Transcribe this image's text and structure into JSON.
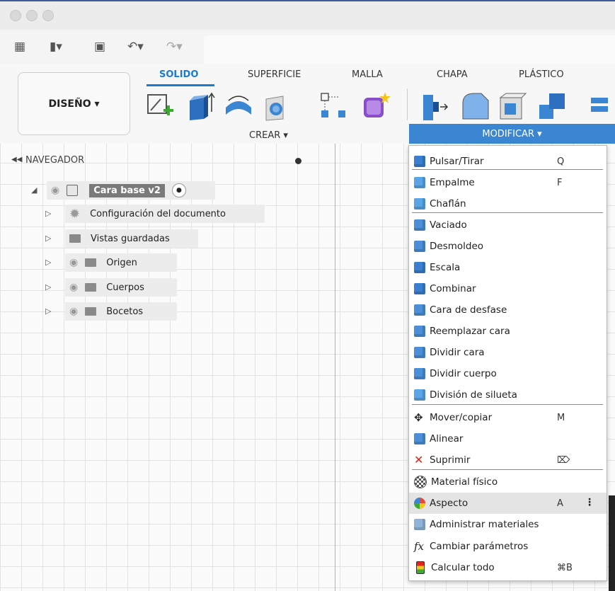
{
  "window": {
    "controls": [
      "close",
      "minimize",
      "zoom"
    ]
  },
  "quick_toolbar": {
    "icons": [
      "grid-icon",
      "file-icon",
      "save-icon",
      "undo-icon",
      "redo-icon"
    ]
  },
  "ribbon": {
    "workspace_button": "DISEÑO ▾",
    "tabs": [
      {
        "label": "SOLIDO",
        "active": true
      },
      {
        "label": "SUPERFICIE",
        "active": false
      },
      {
        "label": "MALLA",
        "active": false
      },
      {
        "label": "CHAPA",
        "active": false
      },
      {
        "label": "PLÁSTICO",
        "active": false
      }
    ],
    "groups": {
      "crear": "CREAR ▾",
      "modificar": "MODIFICAR ▾"
    },
    "accent": "#1a7bd0"
  },
  "navigator": {
    "title": "NAVEGADOR",
    "root": "Cara base v2",
    "items": [
      {
        "label": "Configuración del documento",
        "icon": "gear-icon"
      },
      {
        "label": "Vistas guardadas",
        "icon": "folder-icon"
      },
      {
        "label": "Origen",
        "icon": "folder-icon"
      },
      {
        "label": "Cuerpos",
        "icon": "folder-icon"
      },
      {
        "label": "Bocetos",
        "icon": "folder-icon"
      }
    ]
  },
  "menu": {
    "items": [
      {
        "label": "Pulsar/Tirar",
        "shortcut": "Q",
        "icon": "press-pull-icon",
        "color": "#3a7fd0"
      },
      {
        "label": "Empalme",
        "shortcut": "F",
        "icon": "fillet-icon",
        "color": "#5aa5e8"
      },
      {
        "label": "Chaflán",
        "shortcut": "",
        "icon": "chamfer-icon",
        "color": "#5aa5e8"
      },
      {
        "label": "Vaciado",
        "shortcut": "",
        "icon": "shell-icon",
        "color": "#4a8fd8"
      },
      {
        "label": "Desmoldeo",
        "shortcut": "",
        "icon": "draft-icon",
        "color": "#4a8fd8"
      },
      {
        "label": "Escala",
        "shortcut": "",
        "icon": "scale-icon",
        "color": "#3a7fd0"
      },
      {
        "label": "Combinar",
        "shortcut": "",
        "icon": "combine-icon",
        "color": "#3a7fd0"
      },
      {
        "label": "Cara de desfase",
        "shortcut": "",
        "icon": "offset-face-icon",
        "color": "#4a8fd8"
      },
      {
        "label": "Reemplazar cara",
        "shortcut": "",
        "icon": "replace-face-icon",
        "color": "#4a8fd8"
      },
      {
        "label": "Dividir cara",
        "shortcut": "",
        "icon": "split-face-icon",
        "color": "#4a8fd8"
      },
      {
        "label": "Dividir cuerpo",
        "shortcut": "",
        "icon": "split-body-icon",
        "color": "#4a8fd8"
      },
      {
        "label": "División de silueta",
        "shortcut": "",
        "icon": "silhouette-split-icon",
        "color": "#5aa5e8"
      },
      {
        "label": "Mover/copiar",
        "shortcut": "M",
        "icon": "move-icon",
        "color": "#333333"
      },
      {
        "label": "Alinear",
        "shortcut": "",
        "icon": "align-icon",
        "color": "#4a8fd8"
      },
      {
        "label": "Suprimir",
        "shortcut": "⌦",
        "icon": "delete-icon",
        "color": "#e0261b"
      },
      {
        "label": "Material físico",
        "shortcut": "",
        "icon": "physical-material-icon",
        "color": "#777777"
      },
      {
        "label": "Aspecto",
        "shortcut": "A",
        "icon": "appearance-icon",
        "color": "#e8683a",
        "highlighted": true
      },
      {
        "label": "Administrar materiales",
        "shortcut": "",
        "icon": "manage-materials-icon",
        "color": "#8fb4d8"
      },
      {
        "label": "Cambiar parámetros",
        "shortcut": "",
        "icon": "fx-icon",
        "color": "#333333"
      },
      {
        "label": "Calcular todo",
        "shortcut": "⌘B",
        "icon": "compute-all-icon",
        "color": "#3a9a3a"
      }
    ]
  }
}
